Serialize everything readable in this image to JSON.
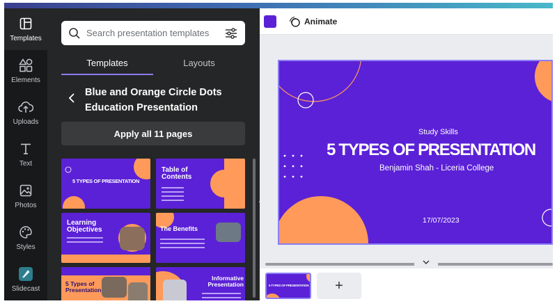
{
  "colors": {
    "rail_bg": "#18191b",
    "panel_bg": "#252627",
    "brand_purple": "#5b21d6",
    "accent_orange": "#ff9a5a",
    "tab_underline": "#8b7cf6"
  },
  "rail": {
    "items": [
      {
        "label": "Templates",
        "icon": "templates-icon"
      },
      {
        "label": "Elements",
        "icon": "elements-icon"
      },
      {
        "label": "Uploads",
        "icon": "uploads-icon"
      },
      {
        "label": "Text",
        "icon": "text-icon"
      },
      {
        "label": "Photos",
        "icon": "photos-icon"
      },
      {
        "label": "Styles",
        "icon": "styles-icon"
      },
      {
        "label": "Slidecast",
        "icon": "slidecast-icon"
      }
    ]
  },
  "panel": {
    "search_placeholder": "Search presentation templates",
    "tabs": [
      {
        "label": "Templates"
      },
      {
        "label": "Layouts"
      }
    ],
    "title": "Blue and Orange Circle Dots Education Presentation",
    "apply_label": "Apply all 11 pages",
    "thumbnails": [
      {
        "title": "5 TYPES OF PRESENTATION"
      },
      {
        "title": "Table of Contents"
      },
      {
        "title": "Learning Objectives"
      },
      {
        "title": "The Benefits"
      },
      {
        "title": "5 Types of Presentation"
      },
      {
        "title": "Informative Presentation"
      }
    ]
  },
  "editor": {
    "animate_label": "Animate",
    "slide": {
      "subtitle": "Study Skills",
      "title": "5 TYPES OF PRESENTATION",
      "author": "Benjamin Shah - Liceria College",
      "date": "17/07/2023"
    },
    "page_thumb_title": "5 TYPES OF PRESENTATION",
    "add_page_label": "+"
  }
}
